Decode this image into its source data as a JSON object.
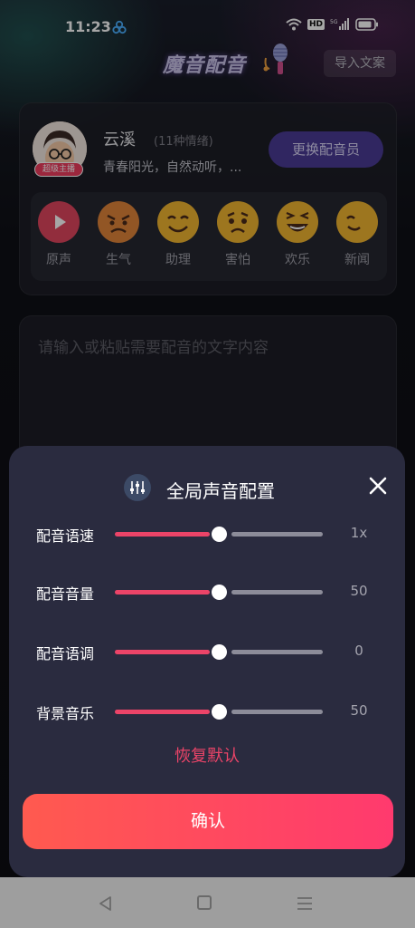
{
  "status_bar": {
    "time": "11:23",
    "network": "5G",
    "icons": [
      "app-icon",
      "wifi-icon",
      "hd-icon",
      "signal-icon",
      "battery-icon"
    ]
  },
  "header": {
    "title": "魔音配音",
    "import_button": "导入文案"
  },
  "voice_card": {
    "name": "云溪",
    "emotion_count": "(11种情绪)",
    "description": "青春阳光，自然动听，...",
    "badge": "超级主播",
    "change_button": "更换配音员",
    "emotions": [
      {
        "label": "原声",
        "icon": "play-icon",
        "color": "#e0455e"
      },
      {
        "label": "生气",
        "icon": "angry-face-icon",
        "color": "#e0843a"
      },
      {
        "label": "助理",
        "icon": "smile-face-icon",
        "color": "#f2b530"
      },
      {
        "label": "害怕",
        "icon": "scared-face-icon",
        "color": "#f2b530"
      },
      {
        "label": "欢乐",
        "icon": "laugh-face-icon",
        "color": "#f2b530"
      },
      {
        "label": "新闻",
        "icon": "face-icon",
        "color": "#f2b530"
      }
    ]
  },
  "editor": {
    "placeholder": "请输入或粘贴需要配音的文字内容"
  },
  "modal": {
    "title": "全局声音配置",
    "sliders": [
      {
        "label": "配音语速",
        "value": "1x",
        "level": 0.5
      },
      {
        "label": "配音音量",
        "value": "50",
        "level": 0.5
      },
      {
        "label": "配音语调",
        "value": "0",
        "level": 0.5
      },
      {
        "label": "背景音乐",
        "value": "50",
        "level": 0.5
      }
    ],
    "reset_label": "恢复默认",
    "confirm_label": "确认"
  },
  "colors": {
    "accent": "#ec4468",
    "modal_bg": "#2a2b3f",
    "confirm_start": "#ff5a4f",
    "confirm_end": "#ff3a6e",
    "change_voice_btn": "#4a3b96"
  }
}
